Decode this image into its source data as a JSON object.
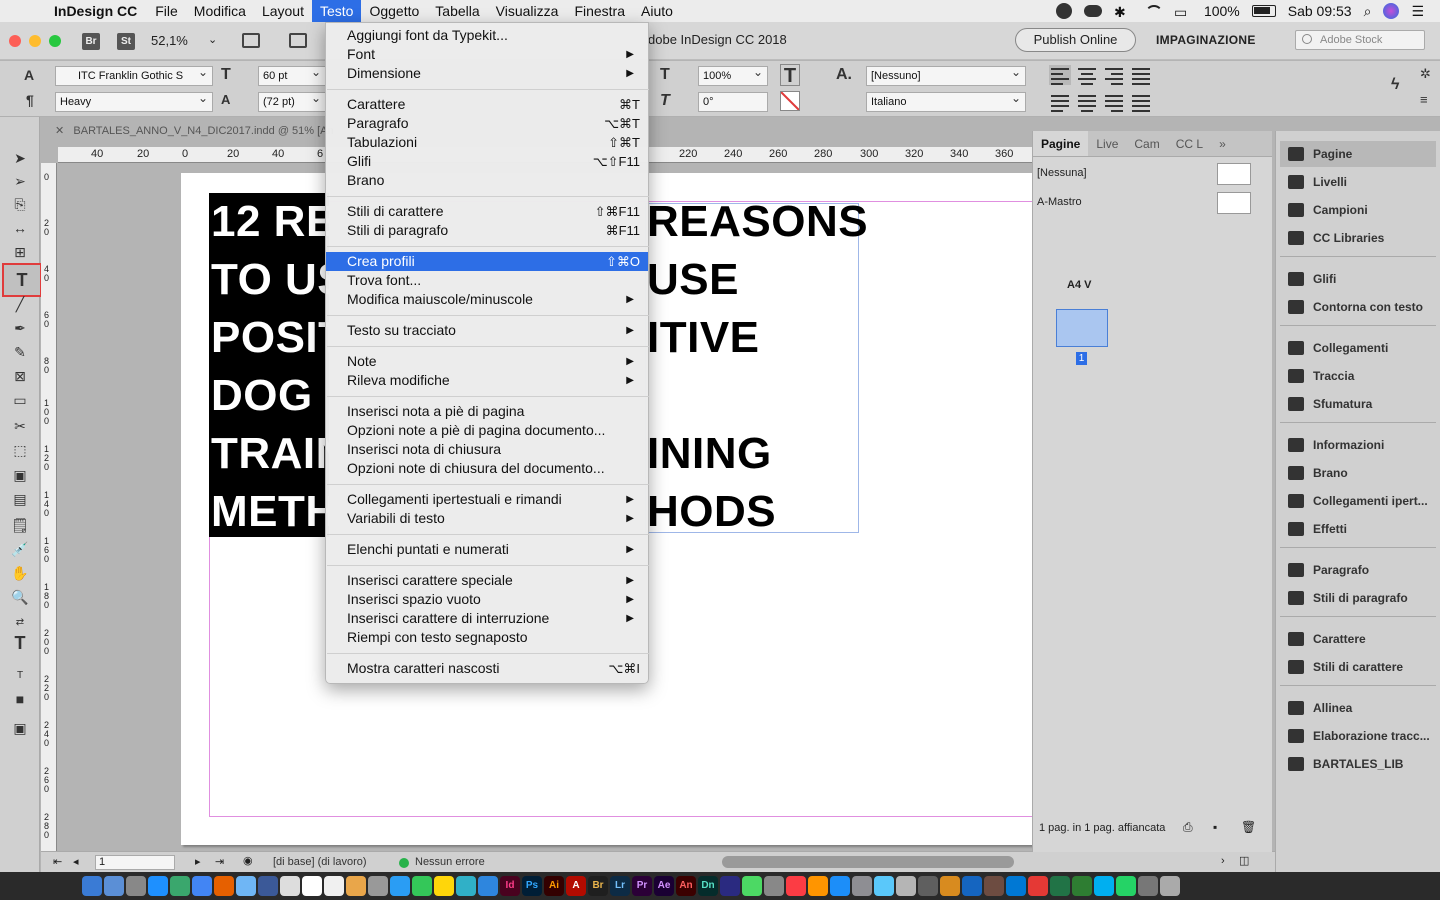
{
  "menubar": {
    "app_name": "InDesign CC",
    "items": [
      "File",
      "Modifica",
      "Layout",
      "Testo",
      "Oggetto",
      "Tabella",
      "Visualizza",
      "Finestra",
      "Aiuto"
    ],
    "active": "Testo",
    "battery": "100%",
    "clock": "Sab 09:53"
  },
  "titlebar": {
    "badge_br": "Br",
    "badge_st": "St",
    "zoom": "52,1%",
    "doc_title": "dobe InDesign CC 2018",
    "publish_label": "Publish Online",
    "workspace_label": "IMPAGINAZIONE",
    "stock_placeholder": "Adobe Stock"
  },
  "controlbar": {
    "font_family": "ITC Franklin Gothic S",
    "font_style": "Heavy",
    "font_size": "60 pt",
    "leading": "(72 pt)",
    "scale": "100%",
    "skew": "0°",
    "char_style": "[Nessuno]",
    "language": "Italiano"
  },
  "document": {
    "tab_label": "BARTALES_ANNO_V_N4_DIC2017.indd @ 51% [An",
    "hruler_labels": [
      "40",
      "20",
      "0",
      "20",
      "40",
      "6",
      "220",
      "240",
      "260",
      "280",
      "300",
      "320",
      "340",
      "360"
    ],
    "vruler_labels": [
      "0",
      "2 0",
      "4 0",
      "6 0",
      "8 0",
      "1 0 0",
      "1 2 0",
      "1 4 0",
      "1 6 0",
      "1 8 0",
      "2 0 0",
      "2 2 0",
      "2 4 0",
      "2 6 0",
      "2 8 0"
    ],
    "black_text": "12 RE\nTO US\nPOSIT\nDOG\nTRAIN\nMETH",
    "white_text": "REASONS\nUSE\nITIVE\n\nINING\nHODS"
  },
  "statusbar": {
    "page": "1",
    "base": "[di base] (di lavoro)",
    "errors": "Nessun errore"
  },
  "pages_panel": {
    "tabs": [
      "Pagine",
      "Live",
      "Cam",
      "CC L"
    ],
    "none_master": "[Nessuna]",
    "a_master": "A-Mastro",
    "page_size": "A4 V",
    "page_number": "1",
    "status": "1 pag. in 1 pag. affiancata"
  },
  "right_dock": {
    "items": [
      "Pagine",
      "Livelli",
      "Campioni",
      "CC Libraries",
      "Glifi",
      "Contorna con testo",
      "Collegamenti",
      "Traccia",
      "Sfumatura",
      "Informazioni",
      "Brano",
      "Collegamenti ipert...",
      "Effetti",
      "Paragrafo",
      "Stili di paragrafo",
      "Carattere",
      "Stili di carattere",
      "Allinea",
      "Elaborazione tracc...",
      "BARTALES_LIB"
    ]
  },
  "testo_menu": {
    "items": [
      {
        "label": "Aggiungi font da Typekit...",
        "shortcut": "",
        "submenu": false
      },
      {
        "label": "Font",
        "shortcut": "",
        "submenu": true
      },
      {
        "label": "Dimensione",
        "shortcut": "",
        "submenu": true
      },
      {
        "label": "Carattere",
        "shortcut": "⌘T",
        "submenu": false
      },
      {
        "label": "Paragrafo",
        "shortcut": "⌥⌘T",
        "submenu": false
      },
      {
        "label": "Tabulazioni",
        "shortcut": "⇧⌘T",
        "submenu": false
      },
      {
        "label": "Glifi",
        "shortcut": "⌥⇧F11",
        "submenu": false
      },
      {
        "label": "Brano",
        "shortcut": "",
        "submenu": false
      },
      {
        "label": "Stili di carattere",
        "shortcut": "⇧⌘F11",
        "submenu": false
      },
      {
        "label": "Stili di paragrafo",
        "shortcut": "⌘F11",
        "submenu": false
      },
      {
        "label": "Crea profili",
        "shortcut": "⇧⌘O",
        "submenu": false
      },
      {
        "label": "Trova font...",
        "shortcut": "",
        "submenu": false
      },
      {
        "label": "Modifica maiuscole/minuscole",
        "shortcut": "",
        "submenu": true
      },
      {
        "label": "Testo su tracciato",
        "shortcut": "",
        "submenu": true
      },
      {
        "label": "Note",
        "shortcut": "",
        "submenu": true
      },
      {
        "label": "Rileva modifiche",
        "shortcut": "",
        "submenu": true
      },
      {
        "label": "Inserisci nota a piè di pagina",
        "shortcut": "",
        "submenu": false
      },
      {
        "label": "Opzioni note a piè di pagina documento...",
        "shortcut": "",
        "submenu": false
      },
      {
        "label": "Inserisci nota di chiusura",
        "shortcut": "",
        "submenu": false
      },
      {
        "label": "Opzioni note di chiusura del documento...",
        "shortcut": "",
        "submenu": false
      },
      {
        "label": "Collegamenti ipertestuali e rimandi",
        "shortcut": "",
        "submenu": true
      },
      {
        "label": "Variabili di testo",
        "shortcut": "",
        "submenu": true
      },
      {
        "label": "Elenchi puntati e numerati",
        "shortcut": "",
        "submenu": true
      },
      {
        "label": "Inserisci carattere speciale",
        "shortcut": "",
        "submenu": true
      },
      {
        "label": "Inserisci spazio vuoto",
        "shortcut": "",
        "submenu": true
      },
      {
        "label": "Inserisci carattere di interruzione",
        "shortcut": "",
        "submenu": true
      },
      {
        "label": "Riempi con testo segnaposto",
        "shortcut": "",
        "submenu": false
      },
      {
        "label": "Mostra caratteri nascosti",
        "shortcut": "⌥⌘I",
        "submenu": false
      }
    ],
    "highlighted": "Crea profili"
  },
  "colors": {
    "accent": "#2d6ee6",
    "selection_outline": "#e03c3c",
    "margin_guide": "#e08fe0"
  }
}
